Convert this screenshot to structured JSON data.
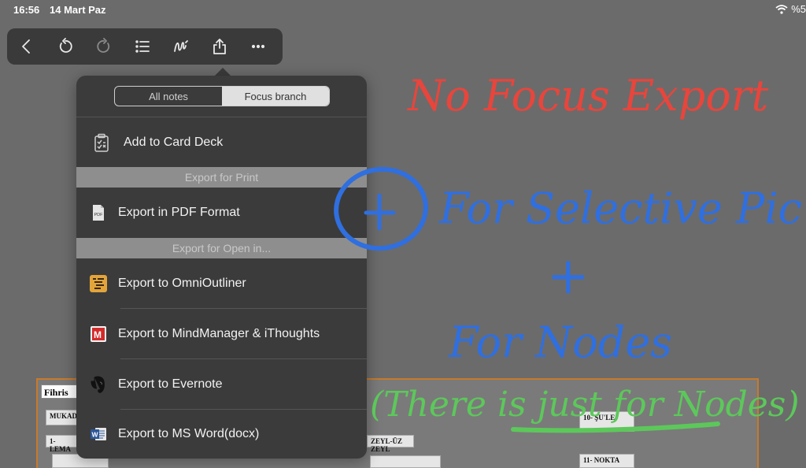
{
  "status": {
    "time": "16:56",
    "date": "14 Mart Paz",
    "battery": "%5"
  },
  "toolbar": {
    "buttons": [
      "back",
      "undo",
      "redo",
      "outline",
      "draw",
      "share",
      "more"
    ]
  },
  "popover": {
    "segments": {
      "all_notes": "All notes",
      "focus_branch": "Focus branch",
      "selected": "focus_branch"
    },
    "items": {
      "card_deck": "Add to Card Deck",
      "print_header": "Export for Print",
      "pdf": "Export in PDF Format",
      "open_header": "Export for Open in...",
      "omni": "Export to OmniOutliner",
      "mindmanager": "Export to MindManager & iThoughts",
      "evernote": "Export to Evernote",
      "word": "Export to MS Word(docx)"
    }
  },
  "canvas": {
    "title_card": "Fihris",
    "cards": [
      "MUKADD",
      "1- LEMA",
      "ZEYL-ÜZ ZEYL",
      "10- ŞU'LE",
      "11- NOKTA"
    ]
  },
  "handwriting": {
    "red": "No Focus Export",
    "blue_line1": "For Selective Pic.",
    "blue_plus": "+",
    "blue_line2": "For Nodes",
    "green": "(There is just for Nodes)",
    "colors": {
      "red": "#e8453c",
      "blue": "#2f6fe0",
      "green": "#5cc85a"
    }
  }
}
